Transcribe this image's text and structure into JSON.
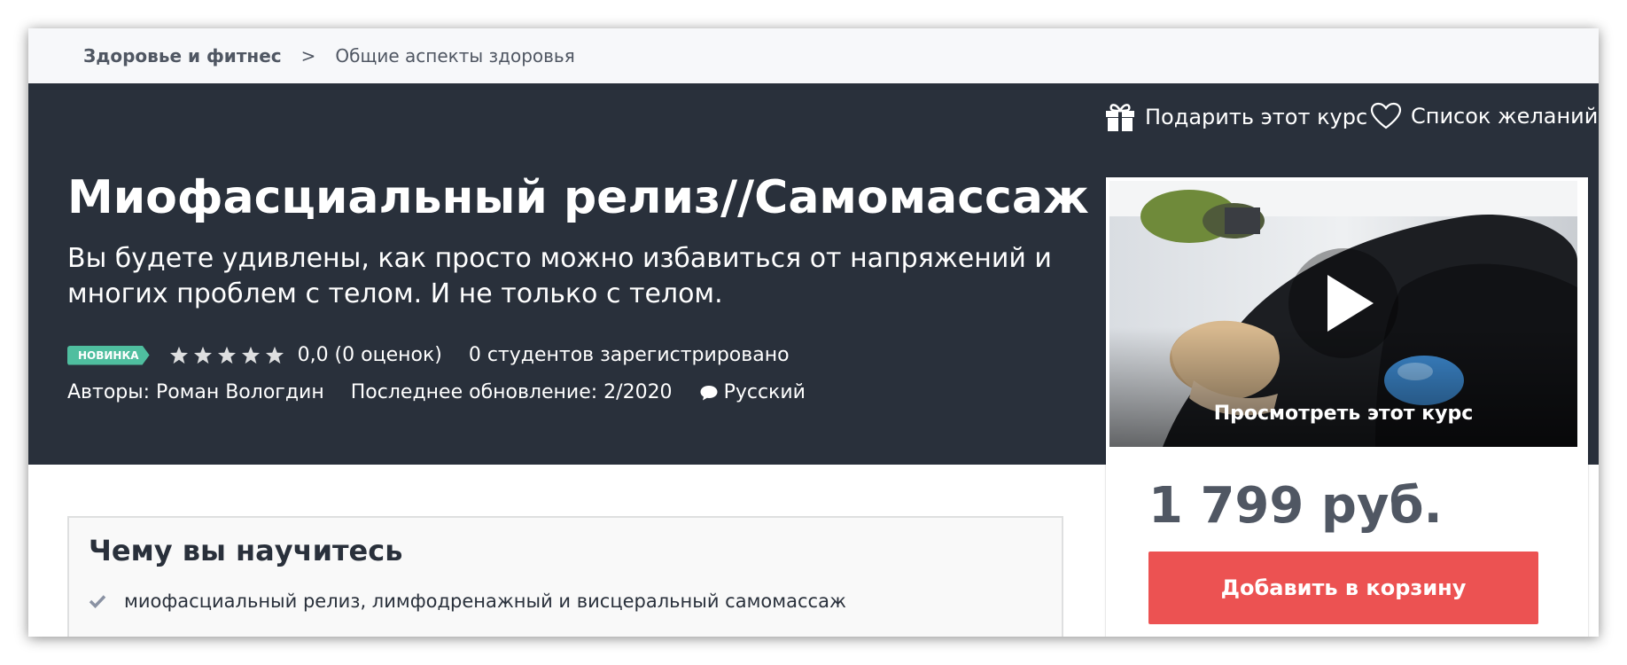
{
  "breadcrumb": {
    "category": "Здоровье и фитнес",
    "separator": ">",
    "subcategory": "Общие аспекты здоровья"
  },
  "header_actions": {
    "gift_label": "Подарить этот курс",
    "gift_icon": "gift-icon",
    "wishlist_label": "Список желаний",
    "wishlist_icon": "heart-icon"
  },
  "course": {
    "title": "Миофасциальный релиз//Самомассаж",
    "subtitle": "Вы будете удивлены, как просто можно избавиться от напряжений и многих проблем с телом. И не только с телом.",
    "badge": "НОВИНКА",
    "stars_total": 5,
    "rating_text": "0,0 (0 оценок)",
    "students_text": "0 студентов зарегистрировано",
    "authors_text": "Авторы: Роман Вологдин",
    "updated_text": "Последнее обновление: 2/2020",
    "language": "Русский",
    "language_icon": "speech-bubble-icon"
  },
  "sidebar": {
    "preview_label": "Просмотреть этот курс",
    "price": "1 799 руб.",
    "cart_button": "Добавить в корзину"
  },
  "learn": {
    "title": "Чему вы научитесь",
    "items": [
      "миофасциальный релиз, лимфодренажный и висцеральный самомассаж"
    ]
  },
  "colors": {
    "hero_bg": "#29303b",
    "badge": "#4fbe9f",
    "cart_button": "#ec5252",
    "price_text": "#505763"
  }
}
